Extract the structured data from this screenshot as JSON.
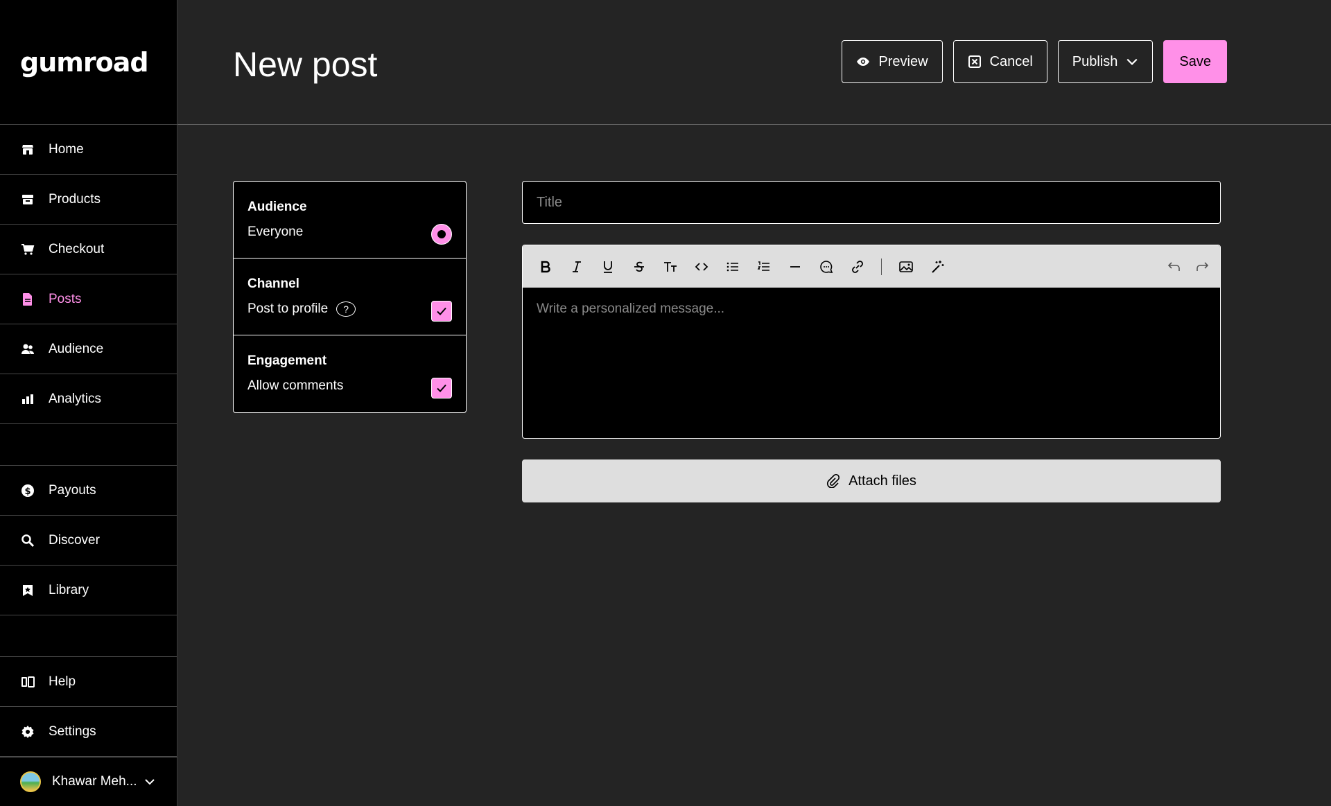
{
  "brand": {
    "logo": "gumroad"
  },
  "sidebar": {
    "items": [
      {
        "label": "Home",
        "icon": "shop-icon"
      },
      {
        "label": "Products",
        "icon": "archive-icon"
      },
      {
        "label": "Checkout",
        "icon": "cart-icon"
      },
      {
        "label": "Posts",
        "icon": "document-icon",
        "active": true
      },
      {
        "label": "Audience",
        "icon": "people-icon"
      },
      {
        "label": "Analytics",
        "icon": "bar-chart-icon"
      },
      {
        "label": "Payouts",
        "icon": "dollar-circle-icon"
      },
      {
        "label": "Discover",
        "icon": "search-icon"
      },
      {
        "label": "Library",
        "icon": "bookmark-icon"
      },
      {
        "label": "Help",
        "icon": "book-icon"
      },
      {
        "label": "Settings",
        "icon": "gear-icon"
      }
    ],
    "user": {
      "name": "Khawar Meh..."
    }
  },
  "header": {
    "title": "New post",
    "preview_label": "Preview",
    "cancel_label": "Cancel",
    "publish_label": "Publish",
    "save_label": "Save"
  },
  "settings": {
    "audience": {
      "title": "Audience",
      "option": "Everyone",
      "selected": true
    },
    "channel": {
      "title": "Channel",
      "option": "Post to profile",
      "help": "?",
      "checked": true
    },
    "engagement": {
      "title": "Engagement",
      "option": "Allow comments",
      "checked": true
    }
  },
  "editor": {
    "title_placeholder": "Title",
    "body_placeholder": "Write a personalized message...",
    "attach_label": "Attach files",
    "toolbar": [
      "bold-icon",
      "italic-icon",
      "underline-icon",
      "strikethrough-icon",
      "text-size-icon",
      "code-icon",
      "bullet-list-icon",
      "numbered-list-icon",
      "horizontal-rule-icon",
      "quote-icon",
      "link-icon",
      "image-icon",
      "magic-icon",
      "undo-icon",
      "redo-icon"
    ]
  },
  "colors": {
    "accent": "#ff90e8",
    "background": "#242424",
    "sidebar": "#000000",
    "toolbar": "#dedede"
  }
}
